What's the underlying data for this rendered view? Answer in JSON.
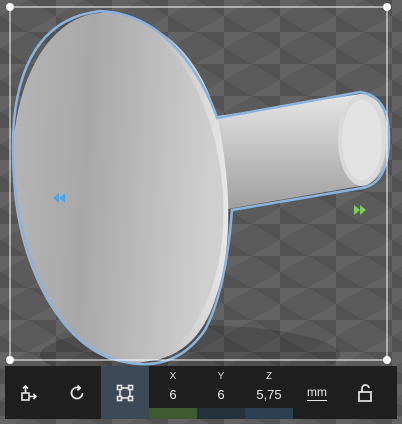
{
  "toolbar": {
    "coordinates": {
      "x": {
        "label": "X",
        "value": "6"
      },
      "y": {
        "label": "Y",
        "value": "6"
      },
      "z": {
        "label": "Z",
        "value": "5,75"
      }
    },
    "unit": "mm"
  },
  "colors": {
    "selection_outline": "#8ab4e0",
    "toolbar_bg": "#1e1e1e",
    "active_tool_bg": "#3d4a56",
    "x_axis_bar": "#3f5a2f",
    "y_axis_bar": "#24303a",
    "z_axis_bar": "#2c3f52",
    "arrow_left": "#4aa8ea",
    "arrow_right": "#7ccf5a"
  },
  "icons": [
    "move-object-icon",
    "rotate-icon",
    "scale-icon",
    "lock-icon"
  ]
}
